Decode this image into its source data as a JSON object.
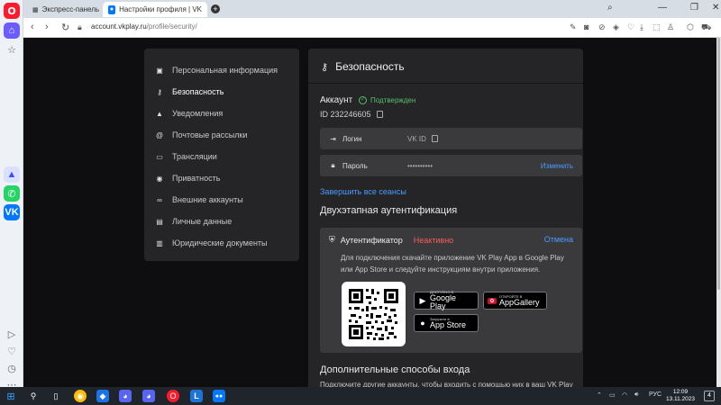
{
  "browser": {
    "tabs": [
      {
        "label": "Экспресс-панель"
      },
      {
        "label": "Настройки профиля | VK"
      }
    ],
    "url_host": "account.vkplay.ru",
    "url_path": "/profile/security/"
  },
  "sidebar": {
    "items": [
      {
        "label": "Персональная информация",
        "icon": "user-icon"
      },
      {
        "label": "Безопасность",
        "icon": "key-icon"
      },
      {
        "label": "Уведомления",
        "icon": "bell-icon"
      },
      {
        "label": "Почтовые рассылки",
        "icon": "at-icon"
      },
      {
        "label": "Трансляции",
        "icon": "camera-icon"
      },
      {
        "label": "Приватность",
        "icon": "eye-icon"
      },
      {
        "label": "Внешние аккаунты",
        "icon": "link-icon"
      },
      {
        "label": "Личные данные",
        "icon": "id-card-icon"
      },
      {
        "label": "Юридические документы",
        "icon": "document-icon"
      }
    ]
  },
  "security": {
    "title": "Безопасность",
    "account_label": "Аккаунт",
    "verified_label": "Подтвержден",
    "account_id": "ID 232246605",
    "login_label": "Логин",
    "login_value": "VK ID",
    "password_label": "Пароль",
    "password_value": "••••••••••",
    "change_label": "Изменить",
    "end_sessions_label": "Завершить все сеансы",
    "twofa_title": "Двухэтапная аутентификация",
    "authenticator_label": "Аутентификатор",
    "authenticator_status": "Неактивно",
    "cancel_label": "Отмена",
    "authenticator_description": "Для подключения скачайте приложение VK Play App в Google Play или App Store и следуйте инструкциям внутри приложения.",
    "stores": {
      "google_small": "ДОСТУПНО В",
      "google_big": "Google Play",
      "huawei_small": "ОТКРОЙТЕ В",
      "huawei_big": "AppGallery",
      "apple_small": "Загрузите в",
      "apple_big": "App Store"
    },
    "extra_title": "Дополнительные способы входа",
    "extra_description": "Подключите другие аккаунты, чтобы входить с помощью них в ваш VK Play аккаунт"
  },
  "taskbar": {
    "language": "РУС",
    "time": "12:09",
    "date": "13.11.2023",
    "notifications": "4"
  },
  "colors": {
    "accent_link": "#4a9bff",
    "verified": "#54c06b",
    "inactive": "#ff5b5b",
    "opera_red": "#ff1b2d"
  }
}
